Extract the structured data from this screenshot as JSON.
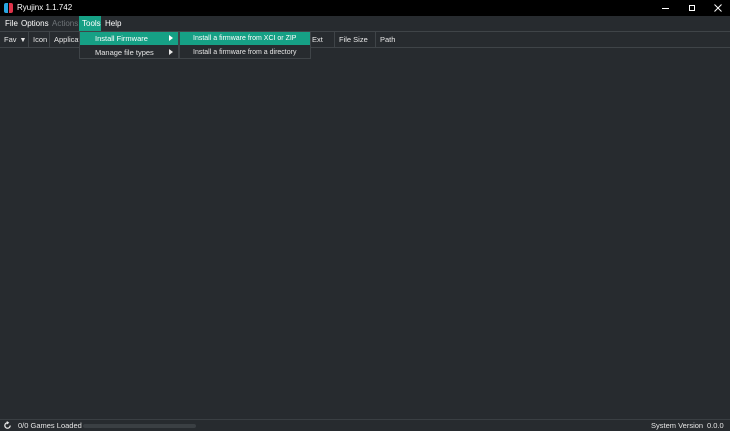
{
  "window": {
    "title": "Ryujinx 1.1.742"
  },
  "menubar": {
    "items": [
      {
        "label": "File",
        "state": "normal"
      },
      {
        "label": "Options",
        "state": "normal"
      },
      {
        "label": "Actions",
        "state": "disabled"
      },
      {
        "label": "Tools",
        "state": "active"
      },
      {
        "label": "Help",
        "state": "normal"
      }
    ]
  },
  "tools_menu": {
    "items": [
      {
        "label": "Install Firmware",
        "has_submenu": true,
        "highlighted": true
      },
      {
        "label": "Manage file types",
        "has_submenu": true,
        "highlighted": false
      }
    ]
  },
  "install_firmware_submenu": {
    "items": [
      {
        "label": "Install a firmware from XCI or ZIP",
        "highlighted": true
      },
      {
        "label": "Install a firmware from a directory",
        "highlighted": false
      }
    ]
  },
  "columns": {
    "fav": "Fav",
    "icon": "Icon",
    "application": "Applicat",
    "ext": "Ext",
    "file_size": "File Size",
    "path": "Path"
  },
  "statusbar": {
    "games_loaded": "0/0 Games Loaded",
    "progress": 0,
    "system_version_label": "System Version",
    "system_version_value": "0.0.0"
  },
  "colors": {
    "accent": "#16a085",
    "background": "#272b2f",
    "titlebar": "#000000"
  }
}
